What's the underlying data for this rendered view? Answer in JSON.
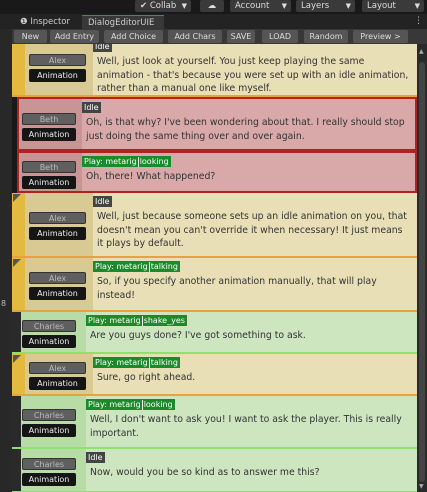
{
  "topbar": {
    "collab": "Collab",
    "account": "Account",
    "layers": "Layers",
    "layout": "Layout"
  },
  "tabs": {
    "inspector": "Inspector",
    "dialog": "DialogEditorUIE"
  },
  "toolbar": [
    "New",
    "Add Entry",
    "Add Choice",
    "Add Chars",
    "SAVE",
    "LOAD",
    "Random",
    "Preview >"
  ],
  "side_number": "8",
  "animation_label": "Animation",
  "colors": {
    "alex_bg": "#e9dfb6",
    "beth_bg": "#d9a9a9",
    "charles_bg": "#cde6c0",
    "tag_play": "#1a8a2a",
    "tag_idle": "#444444"
  },
  "entries": [
    {
      "speaker": "Alex",
      "tag_type": "idle",
      "tag": "Idle",
      "text": "Well, just look at yourself. You just keep playing the same animation - that's because you were set up with an idle animation, rather than a manual one like myself.",
      "flag": false
    },
    {
      "speaker": "Beth",
      "tag_type": "idle",
      "tag": "Idle",
      "text": "Oh, is that why? I've been wondering about that. I really should stop just doing the same thing over and over again.",
      "flag": false
    },
    {
      "speaker": "Beth",
      "tag_type": "play",
      "tag": "Play: metarig",
      "clip": "looking",
      "text": "Oh, there! What happened?",
      "flag": false
    },
    {
      "speaker": "Alex",
      "tag_type": "idle",
      "tag": "Idle",
      "text": "Well, just because someone sets up an idle animation on you, that doesn't mean you can't override it when necessary! It just means it plays by default.",
      "flag": true
    },
    {
      "speaker": "Alex",
      "tag_type": "play",
      "tag": "Play: metarig",
      "clip": "talking",
      "text": "So, if you specify another animation manually, that will play instead!",
      "flag": true
    },
    {
      "speaker": "Charles",
      "tag_type": "play",
      "tag": "Play: metarig",
      "clip": "shake_yes",
      "text": "Are you guys done? I've got something to ask.",
      "flag": false
    },
    {
      "speaker": "Alex",
      "tag_type": "play",
      "tag": "Play: metarig",
      "clip": "talking",
      "text": "Sure, go right ahead.",
      "flag": true
    },
    {
      "speaker": "Charles",
      "tag_type": "play",
      "tag": "Play: metarig",
      "clip": "looking",
      "text": "Well, I don't want to ask you! I want to ask the player. This is really important.",
      "flag": false
    },
    {
      "speaker": "Charles",
      "tag_type": "idle",
      "tag": "Idle",
      "text": "Now, would you be so kind as to answer me this?",
      "flag": false
    }
  ]
}
